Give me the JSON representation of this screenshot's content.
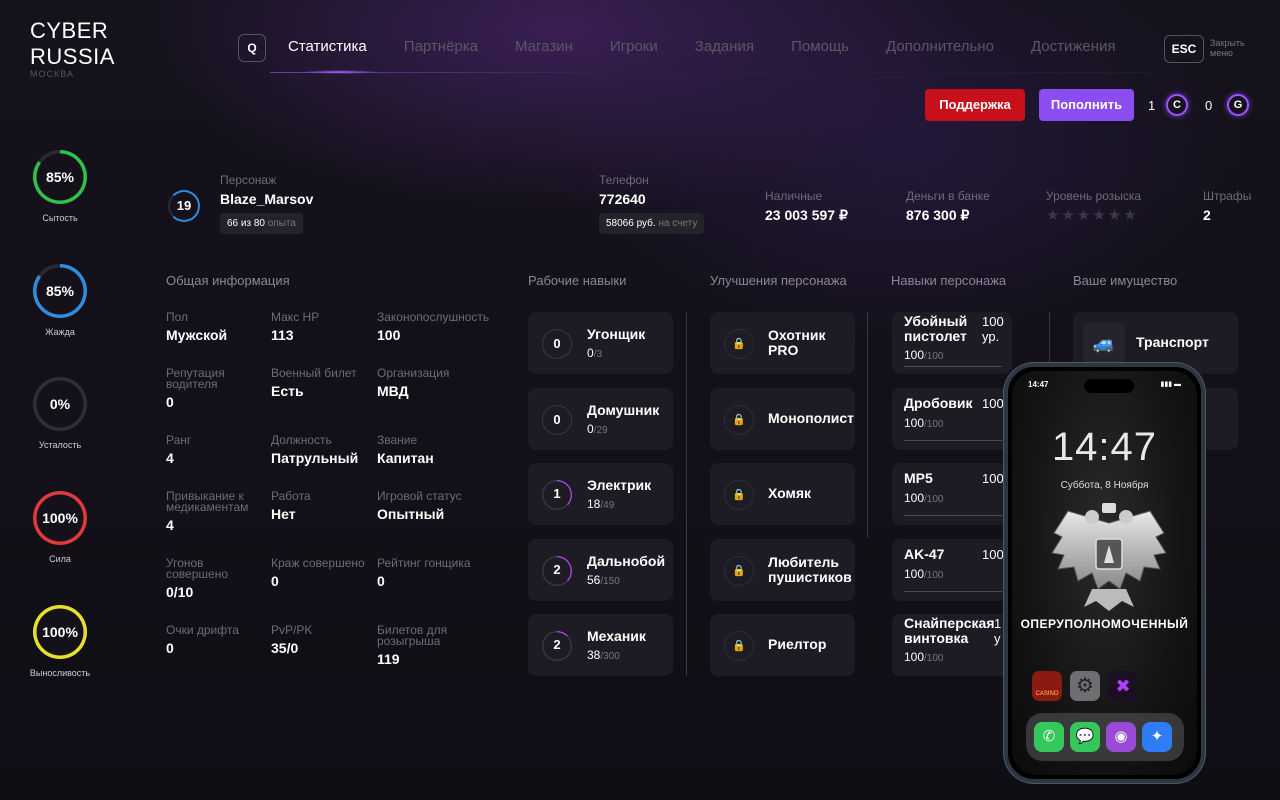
{
  "logo": {
    "line1": "CYBER",
    "line2": "RUSSIA",
    "sub": "МОСКВА"
  },
  "header": {
    "search_key": "Q",
    "nav": [
      "Статистика",
      "Партнёрка",
      "Магазин",
      "Игроки",
      "Задания",
      "Помощь",
      "Дополнительно",
      "Достижения"
    ],
    "esc_key": "ESC",
    "esc_label": "Закрыть меню"
  },
  "actions": {
    "support_label": "Поддержка",
    "topup_label": "Пополнить"
  },
  "currency": [
    {
      "value": "1",
      "symbol": "C"
    },
    {
      "value": "0",
      "symbol": "G"
    }
  ],
  "needs": [
    {
      "label": "Сытость",
      "value": "85%",
      "percent": 85,
      "color": "#2fc14a"
    },
    {
      "label": "Жажда",
      "value": "85%",
      "percent": 85,
      "color": "#2f8de0"
    },
    {
      "label": "Усталость",
      "value": "0%",
      "percent": 0,
      "color": "#888888"
    },
    {
      "label": "Сила",
      "value": "100%",
      "percent": 100,
      "color": "#e03a3a"
    },
    {
      "label": "Выносливость",
      "value": "100%",
      "percent": 100,
      "color": "#e8e02a"
    }
  ],
  "character": {
    "level": "19",
    "name_label": "Персонаж",
    "name": "Blaze_Marsov",
    "exp_value": "66 из 80",
    "exp_unit": "опыта",
    "phone_label": "Телефон",
    "phone": "772640",
    "balance_value": "58066 руб.",
    "balance_unit": "на счету",
    "cash_label": "Наличные",
    "cash": "23 003 597 ₽",
    "bank_label": "Деньги в банке",
    "bank": "876 300 ₽",
    "wanted_label": "Уровень розыска",
    "wanted_stars": 0,
    "wanted_max": 6,
    "fines_label": "Штрафы",
    "fines": "2"
  },
  "sections": {
    "info": "Общая информация",
    "work": "Рабочие навыки",
    "upgrades": "Улучшения персонажа",
    "skills": "Навыки персонажа",
    "property": "Ваше имущество"
  },
  "info": [
    {
      "k": "Пол",
      "v": "Мужской"
    },
    {
      "k": "Макс HP",
      "v": "113"
    },
    {
      "k": "Законопослушность",
      "v": "100"
    },
    {
      "k": "Репутация водителя",
      "v": "0"
    },
    {
      "k": "Военный билет",
      "v": "Есть"
    },
    {
      "k": "Организация",
      "v": "МВД"
    },
    {
      "k": "Ранг",
      "v": "4"
    },
    {
      "k": "Должность",
      "v": "Патрульный"
    },
    {
      "k": "Звание",
      "v": "Капитан"
    },
    {
      "k": "Привыкание к медикаментам",
      "v": "4"
    },
    {
      "k": "Работа",
      "v": "Нет"
    },
    {
      "k": "Игровой статус",
      "v": "Опытный"
    },
    {
      "k": "Угонов совершено",
      "v": "0/10"
    },
    {
      "k": "Краж совершено",
      "v": "0"
    },
    {
      "k": "Рейтинг гонщика",
      "v": "0"
    },
    {
      "k": "Очки дрифта",
      "v": "0"
    },
    {
      "k": "PvP/PK",
      "v": "35/0"
    },
    {
      "k": "Билетов для розыгрыша",
      "v": "119"
    }
  ],
  "work_skills": [
    {
      "level": "0",
      "name": "Угонщик",
      "cur": "0",
      "max": "/3",
      "progress": 0
    },
    {
      "level": "0",
      "name": "Домушник",
      "cur": "0",
      "max": "/29",
      "progress": 0
    },
    {
      "level": "1",
      "name": "Электрик",
      "cur": "18",
      "max": "/49",
      "progress": 0.37
    },
    {
      "level": "2",
      "name": "Дальнобой",
      "cur": "56",
      "max": "/150",
      "progress": 0.37
    },
    {
      "level": "2",
      "name": "Механик",
      "cur": "38",
      "max": "/300",
      "progress": 0.13
    }
  ],
  "upgrades": [
    {
      "line1": "Охотник",
      "line2": "PRO"
    },
    {
      "line1": "Монополист",
      "line2": ""
    },
    {
      "line1": "Хомяк",
      "line2": ""
    },
    {
      "line1": "Любитель",
      "line2": "пушистиков"
    },
    {
      "line1": "Риелтор",
      "line2": ""
    }
  ],
  "weapon_skills": [
    {
      "line1": "Убойный",
      "line2": "пистолет",
      "right1": "100",
      "right2": "ур.",
      "cur": "100",
      "max": "/100"
    },
    {
      "line1": "Дробовик",
      "line2": "",
      "right1": "100",
      "right2": "",
      "cur": "100",
      "max": "/100"
    },
    {
      "line1": "MP5",
      "line2": "",
      "right1": "100",
      "right2": "",
      "cur": "100",
      "max": "/100"
    },
    {
      "line1": "AK-47",
      "line2": "",
      "right1": "100",
      "right2": "",
      "cur": "100",
      "max": "/100"
    },
    {
      "line1": "Снайперская",
      "line2": "винтовка",
      "right1": "1",
      "right2": "у",
      "cur": "100",
      "max": "/100"
    }
  ],
  "property": [
    {
      "name": "Транспорт",
      "icon": "car-icon"
    }
  ],
  "phone": {
    "status_time": "14:47",
    "clock": "14:47",
    "date": "Суббота, 8 Ноября",
    "role": "ОПЕРУПОЛНОМОЧЕННЫЙ",
    "apps": [
      {
        "name": "casino-app-icon",
        "label": "CASINO"
      },
      {
        "name": "settings-app-icon",
        "label": ""
      },
      {
        "name": "game-app-icon",
        "label": ""
      }
    ],
    "dock": [
      "phone-app-icon",
      "messages-app-icon",
      "podcasts-app-icon",
      "safari-app-icon"
    ]
  }
}
